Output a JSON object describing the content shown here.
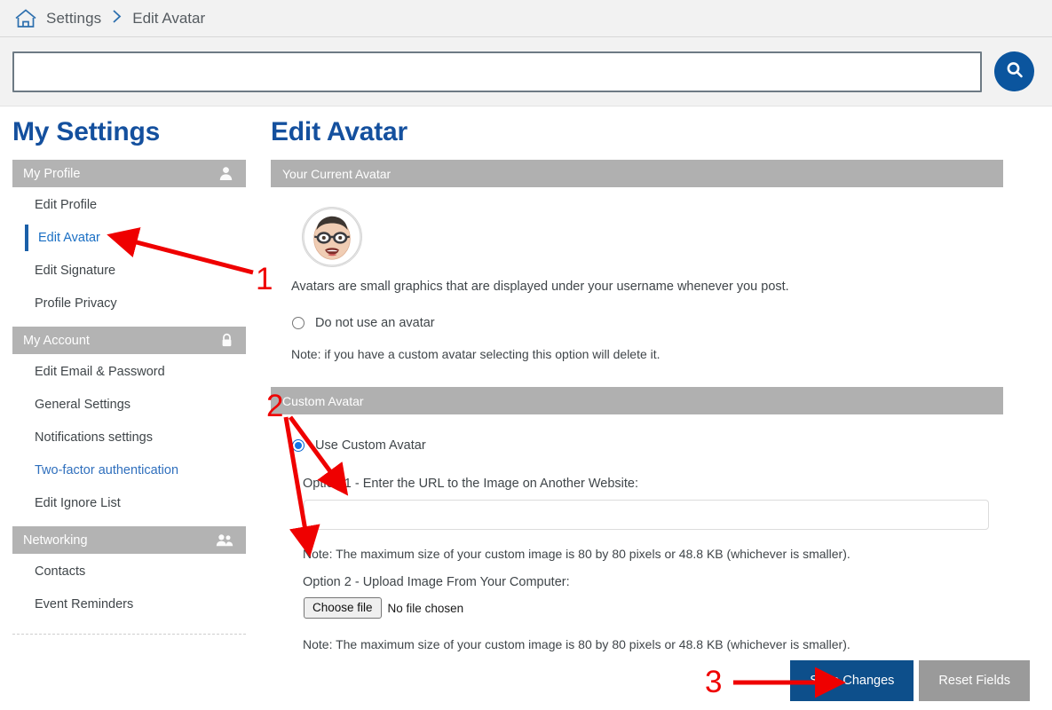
{
  "breadcrumb": {
    "home_icon": "home-icon",
    "root": "Settings",
    "separator": "›",
    "current": "Edit Avatar"
  },
  "search": {
    "value": "",
    "placeholder": "",
    "button_icon": "search-icon"
  },
  "sidebar": {
    "title": "My Settings",
    "groups": [
      {
        "label": "My Profile",
        "icon": "user-icon",
        "items": [
          {
            "label": "Edit Profile",
            "state": "default"
          },
          {
            "label": "Edit Avatar",
            "state": "active"
          },
          {
            "label": "Edit Signature",
            "state": "default"
          },
          {
            "label": "Profile Privacy",
            "state": "default"
          }
        ]
      },
      {
        "label": "My Account",
        "icon": "lock-icon",
        "items": [
          {
            "label": "Edit Email & Password",
            "state": "default"
          },
          {
            "label": "General Settings",
            "state": "default"
          },
          {
            "label": "Notifications settings",
            "state": "default"
          },
          {
            "label": "Two-factor authentication",
            "state": "link"
          },
          {
            "label": "Edit Ignore List",
            "state": "default"
          }
        ]
      },
      {
        "label": "Networking",
        "icon": "users-icon",
        "items": [
          {
            "label": "Contacts",
            "state": "default"
          },
          {
            "label": "Event Reminders",
            "state": "default"
          }
        ]
      }
    ]
  },
  "main": {
    "title": "Edit Avatar",
    "current_avatar": {
      "header": "Your Current Avatar",
      "avatar_alt": "avatar-image",
      "caption": "Avatars are small graphics that are displayed under your username whenever you post.",
      "no_avatar_option": {
        "label": "Do not use an avatar",
        "checked": false
      },
      "note": "Note: if you have a custom avatar selecting this option will delete it."
    },
    "custom_avatar": {
      "header": "Custom Avatar",
      "use_custom_option": {
        "label": "Use Custom Avatar",
        "checked": true
      },
      "option1_label": "Option 1 - Enter the URL to the Image on Another Website:",
      "option1_value": "",
      "option1_placeholder": "",
      "option1_note": "Note: The maximum size of your custom image is 80 by 80 pixels or 48.8 KB (whichever is smaller).",
      "option2_label": "Option 2 - Upload Image From Your Computer:",
      "choose_file_label": "Choose file",
      "file_status": "No file chosen",
      "option2_note": "Note: The maximum size of your custom image is 80 by 80 pixels or 48.8 KB (whichever is smaller)."
    },
    "actions": {
      "save_label": "Save Changes",
      "reset_label": "Reset Fields"
    }
  },
  "annotations": {
    "color": "#ef0000",
    "markers": [
      {
        "number": "1",
        "target": "sidebar-item-edit-avatar"
      },
      {
        "number": "2",
        "target": "custom-avatar-url-and-upload"
      },
      {
        "number": "3",
        "target": "save-changes-button"
      }
    ]
  },
  "colors": {
    "brand_blue": "#14509e",
    "link_blue": "#2f6fbd",
    "panel_gray": "#b0b0b0",
    "primary_button": "#0d4f8b",
    "secondary_button": "#9a9a9a",
    "annotation_red": "#ef0000"
  }
}
